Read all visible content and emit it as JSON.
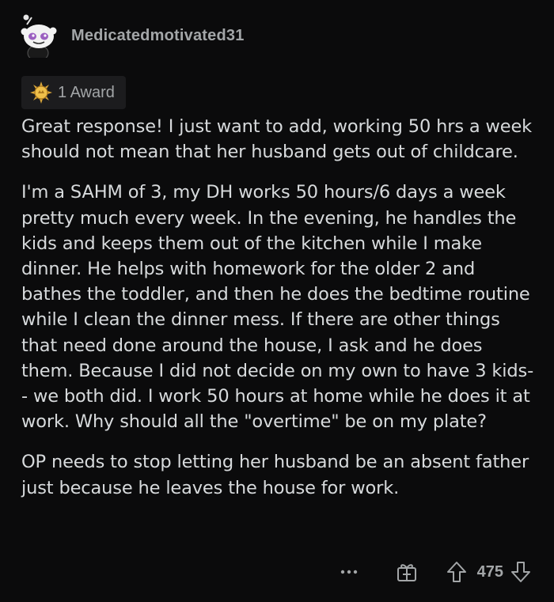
{
  "comment": {
    "author": "Medicatedmotivated31",
    "award_label": "1 Award",
    "paragraphs": [
      "Great response! I just want to add, working 50 hrs a week should not mean that her husband gets out of childcare.",
      "I'm a SAHM of 3, my DH works 50 hours/6 days a week pretty much every week. In the evening, he handles the kids and keeps them out of the kitchen while I make dinner. He helps with homework for the older 2 and bathes the toddler, and then he does the bedtime routine while I clean the dinner mess. If there are other things that need done around the house, I ask and he does them. Because I did not decide on my own to have 3 kids-- we both did. I work 50 hours at home while he does it at work. Why should all the \"overtime\" be on my plate?",
      "OP needs to stop letting her husband be an absent father just because he leaves the house for work."
    ],
    "score": "475"
  },
  "icons": {
    "avatar": "snoo-avatar",
    "award": "gold-award-icon",
    "more": "more-options-icon",
    "gift": "give-award-icon",
    "upvote": "upvote-arrow-icon",
    "downvote": "downvote-arrow-icon"
  },
  "colors": {
    "background": "#0b0b0c",
    "text": "#d7dadc",
    "muted": "#a3a6a8",
    "badge_bg": "#1c1c1e",
    "award_gold": "#d9a63a",
    "avatar_purple": "#9b5fc0"
  }
}
